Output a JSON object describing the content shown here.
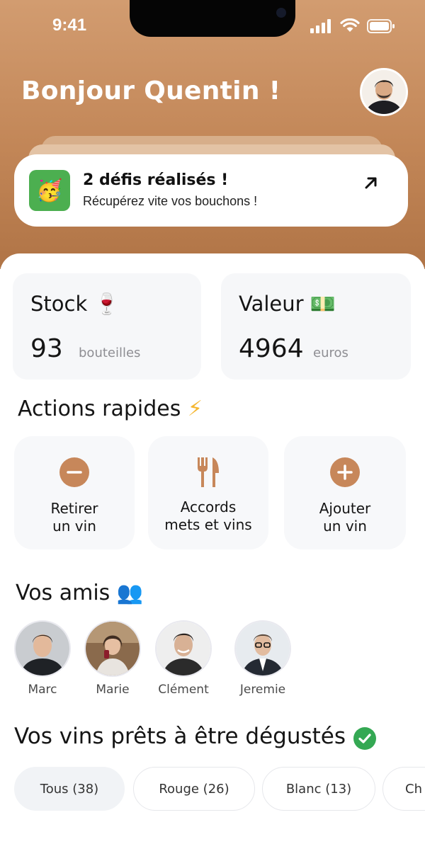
{
  "status_bar": {
    "time": "9:41"
  },
  "header": {
    "greeting": "Bonjour Quentin !",
    "notification": {
      "title": "2 défis réalisés !",
      "subtitle": "Récupérez vite vos bouchons !",
      "icon": "party-face-icon",
      "emoji": "🥳"
    }
  },
  "stats": {
    "stock": {
      "label": "Stock",
      "emoji": "🍷",
      "value": "93",
      "unit": "bouteilles"
    },
    "value": {
      "label": "Valeur",
      "emoji": "💵",
      "value": "4964",
      "unit": "euros"
    }
  },
  "quick_actions": {
    "title": "Actions rapides",
    "emoji": "⚡",
    "items": [
      {
        "label": "Retirer\nun vin",
        "icon": "minus-circle-icon"
      },
      {
        "label": "Accords\nmets et vins",
        "icon": "fork-knife-icon"
      },
      {
        "label": "Ajouter\nun vin",
        "icon": "plus-circle-icon"
      }
    ]
  },
  "friends": {
    "title": "Vos amis",
    "emoji": "👥",
    "items": [
      {
        "name": "Marc"
      },
      {
        "name": "Marie"
      },
      {
        "name": "Clément"
      },
      {
        "name": "Jeremie"
      }
    ]
  },
  "wines": {
    "title": "Vos vins prêts à être dégustés",
    "filters": [
      {
        "label": "Tous (38)",
        "active": true
      },
      {
        "label": "Rouge (26)",
        "active": false
      },
      {
        "label": "Blanc (13)",
        "active": false
      },
      {
        "label": "Ch",
        "active": false
      }
    ]
  },
  "colors": {
    "header_top": "#d29c70",
    "header_bottom": "#b07446",
    "accent": "#c7875a",
    "card_bg": "#f6f7f9",
    "success": "#34a853"
  }
}
